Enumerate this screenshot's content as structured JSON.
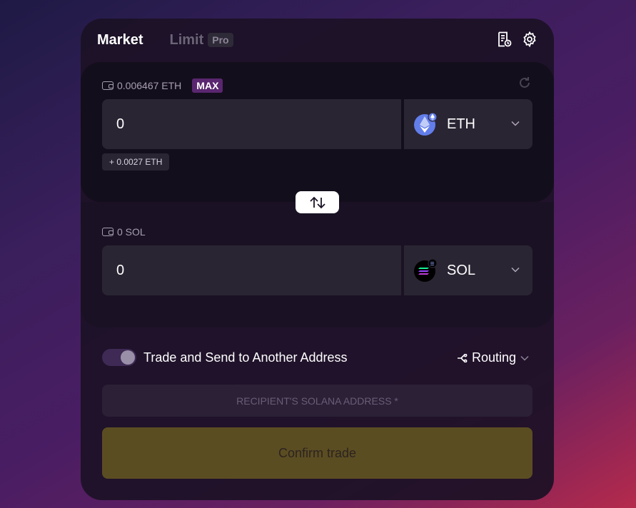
{
  "tabs": {
    "market": "Market",
    "limit": "Limit",
    "pro_badge": "Pro"
  },
  "header_icons": {
    "history": "receipt-history-icon",
    "settings": "gear-icon"
  },
  "from": {
    "balance": "0.006467 ETH",
    "max_label": "MAX",
    "amount": "0",
    "token": "ETH",
    "fee_hint": "+ 0.0027 ETH"
  },
  "to": {
    "balance": "0 SOL",
    "amount": "0",
    "token": "SOL"
  },
  "toggle": {
    "label": "Trade and Send to Another Address",
    "on": true
  },
  "routing": {
    "label": "Routing"
  },
  "recipient": {
    "placeholder": "RECIPIENT'S SOLANA ADDRESS *",
    "value": ""
  },
  "confirm": {
    "label": "Confirm trade"
  },
  "colors": {
    "accent_purple": "#5a2670",
    "confirm_bg": "#5b4d22",
    "eth_blue": "#627eea"
  }
}
